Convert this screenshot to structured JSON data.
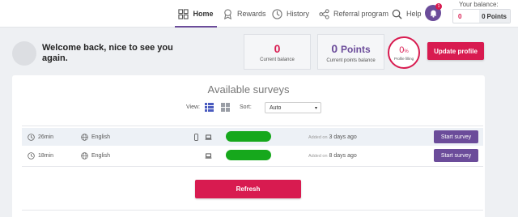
{
  "nav": {
    "items": [
      {
        "label": "Home",
        "icon": "grid-icon"
      },
      {
        "label": "Rewards",
        "icon": "medal-icon"
      },
      {
        "label": "History",
        "icon": "clock-icon"
      },
      {
        "label": "Referral program",
        "icon": "share-icon"
      },
      {
        "label": "Help",
        "icon": "search-icon"
      }
    ],
    "notification_count": "1"
  },
  "balance": {
    "label": "Your balance:",
    "money": "0",
    "points_value": "0",
    "points_unit": "Points"
  },
  "welcome": {
    "text": "Welcome back, nice to see you again."
  },
  "stats": {
    "current_balance_value": "0",
    "current_balance_label": "Current balance",
    "points_value": "0",
    "points_unit": "Points",
    "points_label": "Current points balance",
    "profile_percent": "0",
    "profile_percent_sign": "%",
    "profile_label": "Profile filling"
  },
  "buttons": {
    "update_profile": "Update profile",
    "refresh": "Refresh",
    "start_survey": "Start survey"
  },
  "surveys": {
    "title": "Available surveys",
    "view_label": "View:",
    "sort_label": "Sort:",
    "sort_value": "Auto",
    "added_prefix": "Added on",
    "rows": [
      {
        "duration": "26min",
        "language": "English",
        "added": "3 days ago",
        "devices": [
          "phone-icon",
          "laptop-icon"
        ],
        "reward_fill": 1.0
      },
      {
        "duration": "18min",
        "language": "English",
        "added": "8 days ago",
        "devices": [
          "laptop-icon"
        ],
        "reward_fill": 1.0
      }
    ]
  },
  "colors": {
    "accent_purple": "#6b4c9a",
    "accent_pink": "#d81b50",
    "reward_green": "#16a81c"
  }
}
